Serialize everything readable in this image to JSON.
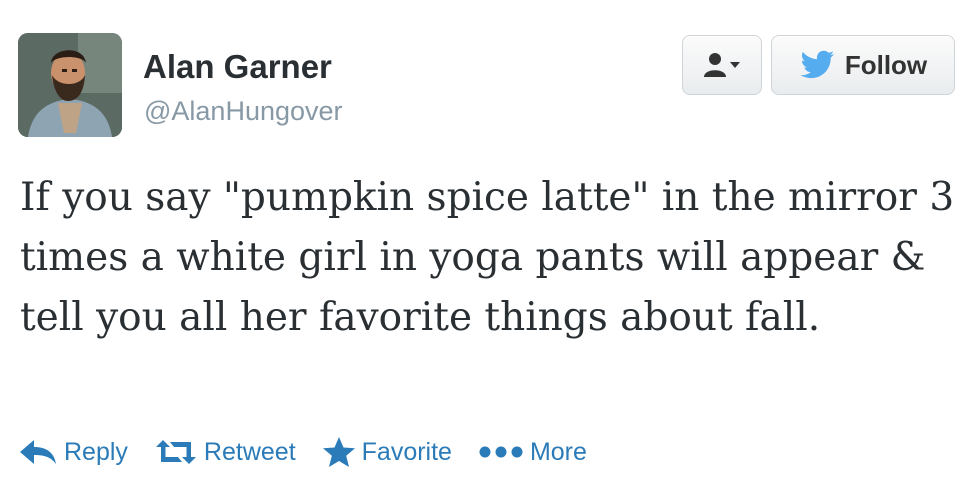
{
  "user": {
    "name": "Alan Garner",
    "handle": "@AlanHungover",
    "avatar_icon": "profile-photo"
  },
  "buttons": {
    "user_menu_icon": "user-dropdown-icon",
    "follow_label": "Follow",
    "follow_icon": "twitter-bird-icon"
  },
  "tweet": {
    "text": "If you say \"pumpkin spice latte\" in the mirror 3 times a white girl in yoga pants will appear & tell you all her favorite things about fall."
  },
  "actions": {
    "reply": "Reply",
    "retweet": "Retweet",
    "favorite": "Favorite",
    "more": "More"
  },
  "colors": {
    "action_blue": "#2b7bb9",
    "text_dark": "#292f33",
    "handle_gray": "#8899a6",
    "twitter_blue": "#55acee"
  }
}
